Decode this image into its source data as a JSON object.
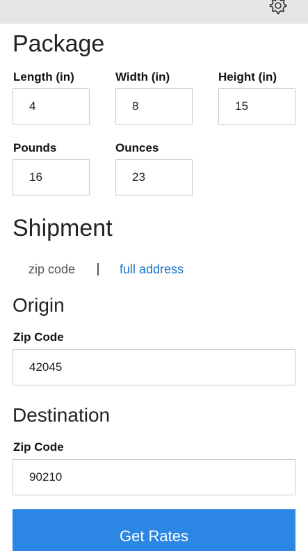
{
  "icons": {
    "settings": "gear-icon"
  },
  "package": {
    "title": "Package",
    "length": {
      "label": "Length (in)",
      "value": "4"
    },
    "width": {
      "label": "Width (in)",
      "value": "8"
    },
    "height": {
      "label": "Height (in)",
      "value": "15"
    },
    "pounds": {
      "label": "Pounds",
      "value": "16"
    },
    "ounces": {
      "label": "Ounces",
      "value": "23"
    }
  },
  "shipment": {
    "title": "Shipment",
    "toggle_zip": "zip code",
    "toggle_full": "full address",
    "link_color": "#1a73c9"
  },
  "origin": {
    "title": "Origin",
    "zip_label": "Zip Code",
    "zip_value": "42045"
  },
  "destination": {
    "title": "Destination",
    "zip_label": "Zip Code",
    "zip_value": "90210"
  },
  "actions": {
    "get_rates": "Get Rates",
    "button_color": "#2b87e3"
  }
}
